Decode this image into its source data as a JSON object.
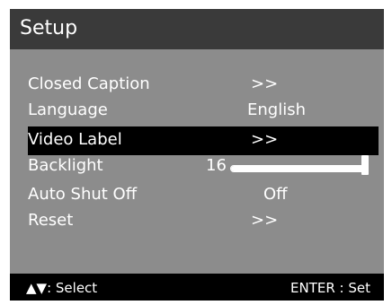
{
  "header": {
    "title": "Setup"
  },
  "menu": {
    "items": [
      {
        "label": "Closed Caption",
        "value": ">>"
      },
      {
        "label": "Language",
        "value": "English"
      },
      {
        "label": "Video Label",
        "value": ">>"
      },
      {
        "label": "Backlight",
        "value": "16",
        "level": 1.0
      },
      {
        "label": "Auto Shut Off",
        "value": "Off"
      },
      {
        "label": "Reset",
        "value": ">>"
      }
    ],
    "selected_index": 2
  },
  "footer": {
    "left_icons": "▲▼",
    "left_label": ": Select",
    "right_label": "ENTER : Set"
  },
  "colors": {
    "header_bg": "#3a3a3a",
    "body_bg": "#8c8c8c",
    "highlight_bg": "#000000",
    "text": "#ffffff"
  }
}
